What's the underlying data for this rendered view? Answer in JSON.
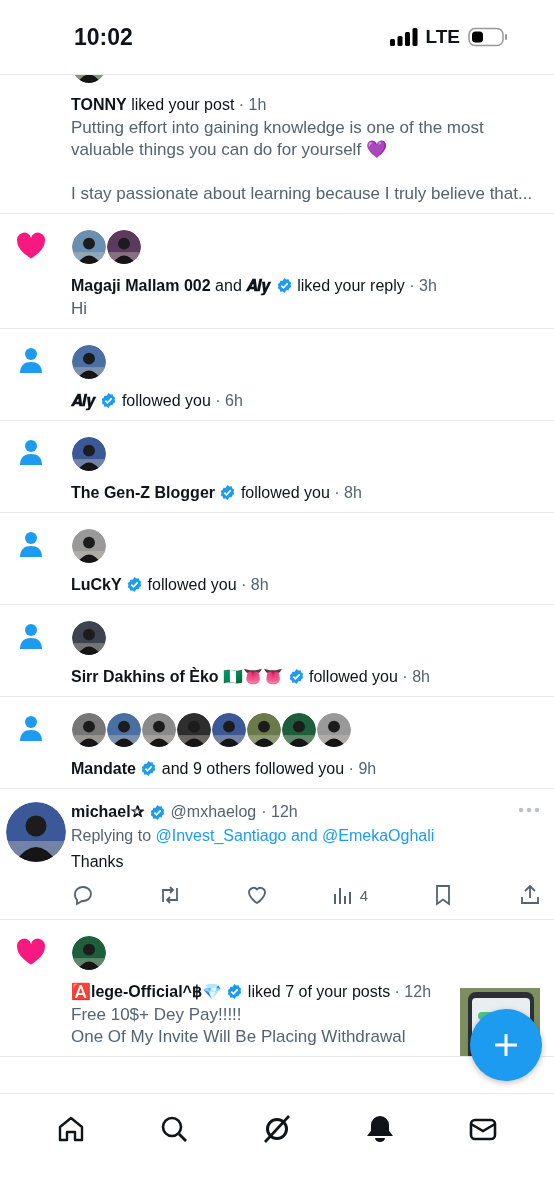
{
  "status_bar": {
    "time": "10:02",
    "network": "LTE"
  },
  "notifications": [
    {
      "kind": "like",
      "cut_top": true,
      "avatars": [
        {
          "kind": "picture"
        }
      ],
      "actors": [
        {
          "name": "TONNY",
          "verified": false
        }
      ],
      "action": "liked your post",
      "time": "· 1h",
      "body": "Putting effort into gaining knowledge is one of the most valuable things you can do for yourself 💜\n\nI stay passionate about learning because I truly believe that..."
    },
    {
      "kind": "like",
      "cut_top": false,
      "avatars": [
        {
          "kind": "picture"
        },
        {
          "kind": "picture"
        }
      ],
      "actors": [
        {
          "name": "Magaji Mallam 002",
          "verified": false
        },
        {
          "name": "𝑨𝒍𝒚",
          "verified": true
        }
      ],
      "joiner": "and",
      "action": "liked your reply",
      "time": "· 3h",
      "body": "Hi"
    },
    {
      "kind": "follow",
      "cut_top": false,
      "avatars": [
        {
          "kind": "picture"
        }
      ],
      "actors": [
        {
          "name": "𝑨𝒍𝒚",
          "verified": true
        }
      ],
      "action": "followed you",
      "time": "· 6h"
    },
    {
      "kind": "follow",
      "cut_top": false,
      "avatars": [
        {
          "kind": "picture"
        }
      ],
      "actors": [
        {
          "name": "The Gen-Z Blogger",
          "verified": true
        }
      ],
      "action": "followed you",
      "time": "· 8h"
    },
    {
      "kind": "follow",
      "cut_top": false,
      "avatars": [
        {
          "kind": "picture"
        }
      ],
      "actors": [
        {
          "name": "LuCkY",
          "verified": true
        }
      ],
      "action": "followed you",
      "time": "· 8h"
    },
    {
      "kind": "follow",
      "cut_top": false,
      "avatars": [
        {
          "kind": "picture"
        }
      ],
      "actors": [
        {
          "name": "Sirr Dakhins of Èko 🇳🇬👅👅",
          "verified": true
        }
      ],
      "action": "followed you",
      "time": "· 8h"
    },
    {
      "kind": "follow",
      "cut_top": false,
      "avatars": [
        {
          "kind": "picture"
        },
        {
          "kind": "picture"
        },
        {
          "kind": "picture"
        },
        {
          "kind": "picture"
        },
        {
          "kind": "picture"
        },
        {
          "kind": "picture"
        },
        {
          "kind": "picture"
        },
        {
          "kind": "picture"
        }
      ],
      "actors": [
        {
          "name": "Mandate",
          "verified": true
        }
      ],
      "action": "and 9 others followed you",
      "time": "· 9h"
    },
    {
      "kind": "reply",
      "cut_top": false,
      "author": "michael✰",
      "verified": true,
      "handle": "@mxhaelog",
      "time": "· 12h",
      "replying": "Replying to",
      "mentions": "@Invest_Santiago and @EmekaOghali",
      "text": "Thanks",
      "views": "4"
    },
    {
      "kind": "like",
      "cut_top": false,
      "avatars": [
        {
          "kind": "picture"
        }
      ],
      "actors": [
        {
          "name": "🅰️lege-Official^฿💎",
          "verified": true
        }
      ],
      "action": "liked 7 of your posts",
      "time": "· 12h",
      "body": "Free 10$+ Dey Pay!!!!!\nOne Of My Invite Will Be Placing Withdrawal",
      "thumbnail": {
        "kind": "picture"
      }
    }
  ],
  "tabs": [
    {
      "selected": false
    },
    {
      "selected": false
    },
    {
      "selected": false
    },
    {
      "selected": true
    },
    {
      "selected": false
    }
  ]
}
